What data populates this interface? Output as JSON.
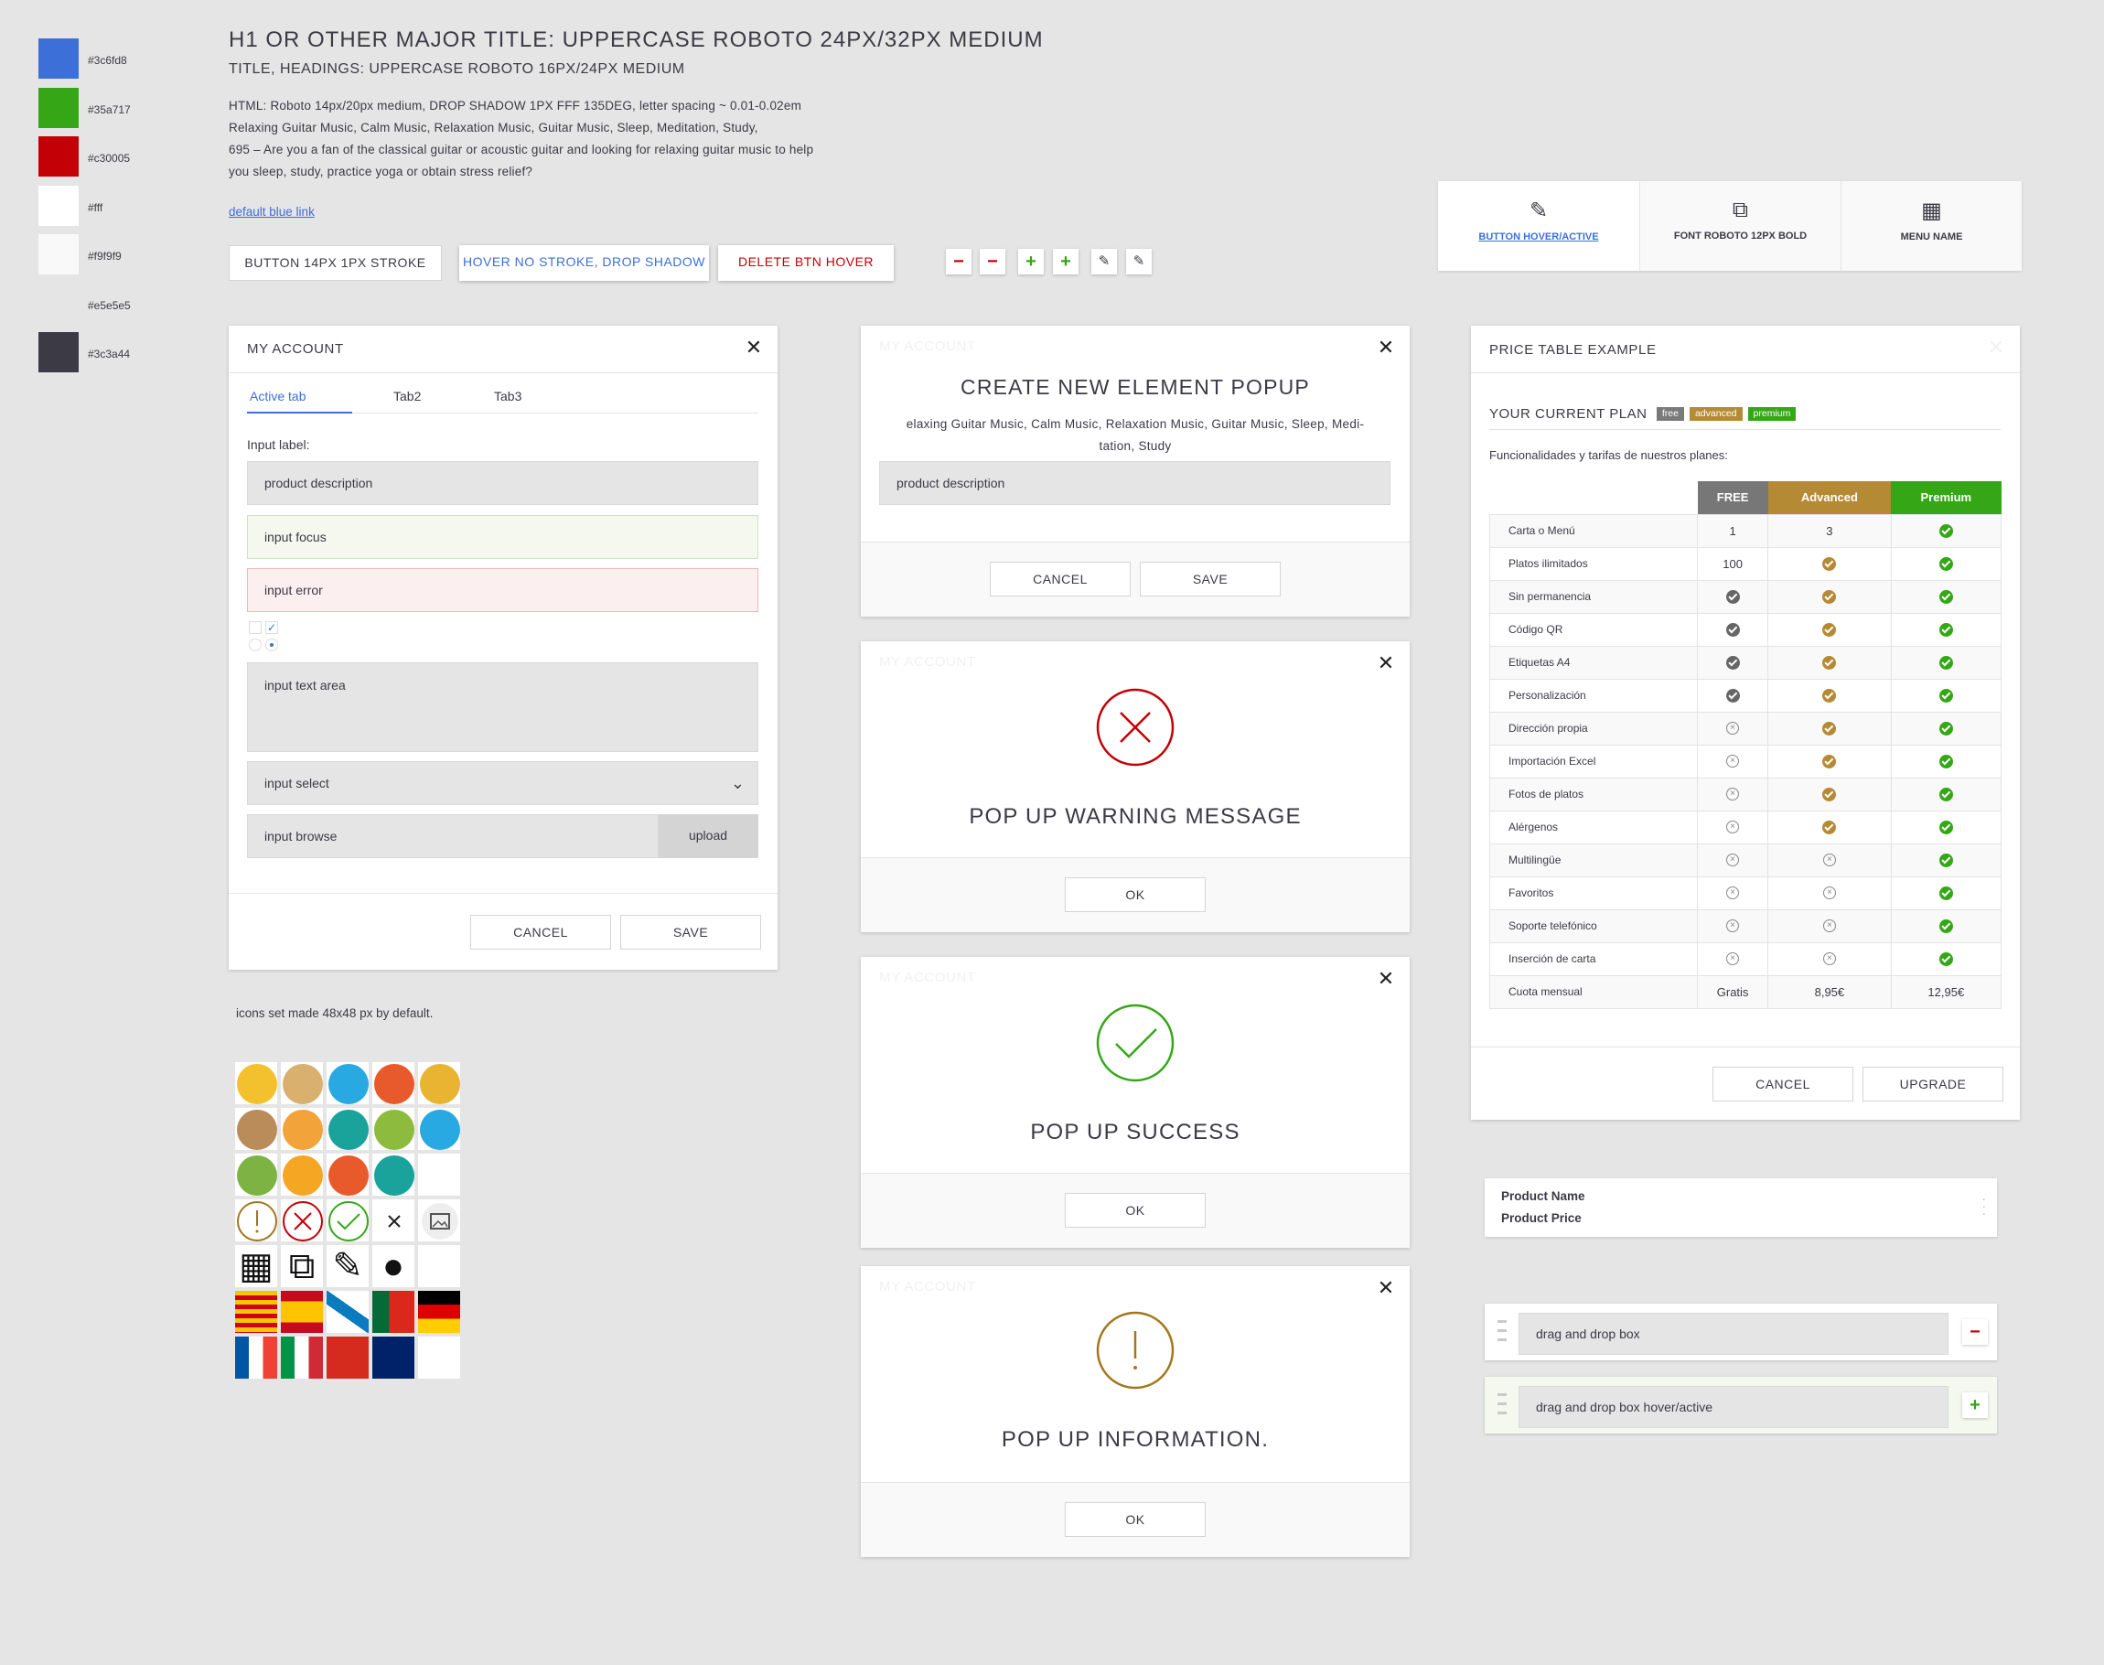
{
  "palette": [
    {
      "hex": "#3c6fd8",
      "label": "#3c6fd8"
    },
    {
      "hex": "#35a717",
      "label": "#35a717"
    },
    {
      "hex": "#c30005",
      "label": "#c30005"
    },
    {
      "hex": "#ffffff",
      "label": "#fff"
    },
    {
      "hex": "#f9f9f9",
      "label": "#f9f9f9"
    },
    {
      "hex": "#e5e5e5",
      "label": "#e5e5e5"
    },
    {
      "hex": "#3c3a44",
      "label": "#3c3a44"
    }
  ],
  "typography": {
    "h1": "H1 OR OTHER MAJOR TITLE: UPPERCASE ROBOTO 24PX/32PX MEDIUM",
    "h2": "TITLE, HEADINGS: UPPERCASE ROBOTO 16PX/24PX MEDIUM",
    "lines": [
      "HTML: Roboto 14px/20px medium, DROP SHADOW 1PX FFF 135DEG, letter spacing ~ 0.01-0.02em",
      "Relaxing Guitar Music, Calm Music, Relaxation Music, Guitar Music, Sleep, Meditation, Study,",
      "695 – Are you a fan of the classical guitar or acoustic guitar and looking for relaxing guitar music to help",
      "you sleep, study, practice yoga or obtain stress relief?"
    ],
    "link": "default blue link"
  },
  "buttons": {
    "stroke": "BUTTON 14PX 1PX STROKE",
    "hover": "HOVER NO STROKE, DROP SHADOW",
    "delete": "DELETE BTN HOVER",
    "small": [
      "minus",
      "minus",
      "plus",
      "plus",
      "pencil",
      "pencil"
    ]
  },
  "menu": {
    "items": [
      {
        "label": "BUTTON HOVER/ACTIVE",
        "icon": "pencil-icon"
      },
      {
        "label": "FONT ROBOTO 12PX BOLD",
        "icon": "external-link-icon"
      },
      {
        "label": "MENU NAME",
        "icon": "qr-code-icon"
      }
    ]
  },
  "account": {
    "title": "MY ACCOUNT",
    "tabs": [
      "Active tab",
      "Tab2",
      "Tab3"
    ],
    "input_label": "Input label:",
    "field_default": "product description",
    "field_focus": "input focus",
    "field_error": "input error",
    "textarea": "input text area",
    "select": "input select",
    "browse": "input browse",
    "upload": "upload",
    "cancel": "CANCEL",
    "save": "SAVE"
  },
  "create_popup": {
    "ghost": "MY ACCOUNT",
    "title": "CREATE NEW ELEMENT POPUP",
    "desc1": "elaxing Guitar Music, Calm Music, Relaxation Music, Guitar Music, Sleep, Medi-",
    "desc2": "tation, Study",
    "field": "product description",
    "cancel": "CANCEL",
    "save": "SAVE"
  },
  "warning_popup": {
    "ghost": "MY ACCOUNT",
    "title": "POP UP WARNING MESSAGE",
    "ok": "OK",
    "color": "#c30005"
  },
  "success_popup": {
    "ghost": "MY ACCOUNT",
    "title": "POP UP SUCCESS",
    "ok": "OK",
    "color": "#35a717"
  },
  "info_popup": {
    "ghost": "MY ACCOUNT",
    "title": "POP UP INFORMATION.",
    "ok": "OK",
    "color": "#a2771c"
  },
  "price": {
    "title": "PRICE TABLE EXAMPLE",
    "plan_label": "YOUR CURRENT PLAN",
    "badges": [
      {
        "label": "free",
        "color": "#7a7a7a"
      },
      {
        "label": "advanced",
        "color": "#b58a34"
      },
      {
        "label": "premium",
        "color": "#35a717"
      }
    ],
    "subtitle": "Funcionalidades y tarifas de nuestros planes:",
    "columns": [
      {
        "label": "FREE",
        "color": "#777777"
      },
      {
        "label": "Advanced",
        "color": "#b58a34"
      },
      {
        "label": "Premium",
        "color": "#35a717"
      }
    ],
    "rows": [
      {
        "feature": "Carta o Menú",
        "free": "1",
        "advanced": "3",
        "premium": "check"
      },
      {
        "feature": "Platos ilimitados",
        "free": "100",
        "advanced": "check",
        "premium": "check"
      },
      {
        "feature": "Sin permanencia",
        "free": "check",
        "advanced": "check",
        "premium": "check"
      },
      {
        "feature": "Código QR",
        "free": "check",
        "advanced": "check",
        "premium": "check"
      },
      {
        "feature": "Etiquetas A4",
        "free": "check",
        "advanced": "check",
        "premium": "check"
      },
      {
        "feature": "Personalización",
        "free": "check",
        "advanced": "check",
        "premium": "check"
      },
      {
        "feature": "Dirección propia",
        "free": "x",
        "advanced": "check",
        "premium": "check"
      },
      {
        "feature": "Importación Excel",
        "free": "x",
        "advanced": "check",
        "premium": "check"
      },
      {
        "feature": "Fotos de platos",
        "free": "x",
        "advanced": "check",
        "premium": "check"
      },
      {
        "feature": "Alérgenos",
        "free": "x",
        "advanced": "check",
        "premium": "check"
      },
      {
        "feature": "Multilingüe",
        "free": "x",
        "advanced": "x",
        "premium": "check"
      },
      {
        "feature": "Favoritos",
        "free": "x",
        "advanced": "x",
        "premium": "check"
      },
      {
        "feature": "Soporte telefónico",
        "free": "x",
        "advanced": "x",
        "premium": "check"
      },
      {
        "feature": "Inserción de carta",
        "free": "x",
        "advanced": "x",
        "premium": "check"
      },
      {
        "feature": "Cuota mensual",
        "free": "Gratis",
        "advanced": "8,95€",
        "premium": "12,95€"
      }
    ],
    "cancel": "CANCEL",
    "upgrade": "UPGRADE"
  },
  "product": {
    "name": "Product Name",
    "price": "Product Price"
  },
  "dnd": {
    "box": "drag and drop box",
    "box_active": "drag and drop box hover/active"
  },
  "icons": {
    "caption": "icons set made 48x48 px by default.",
    "rows": [
      [
        {
          "n": "wheat-icon",
          "c": "#f4c12e"
        },
        {
          "n": "shellfish-icon",
          "c": "#d9b06e"
        },
        {
          "n": "milk-icon",
          "c": "#29a9e1"
        },
        {
          "n": "celery-icon",
          "c": "#e85a2c"
        },
        {
          "n": "mustard-icon",
          "c": "#e8b432"
        }
      ],
      [
        {
          "n": "nuts-icon",
          "c": "#b98c5a"
        },
        {
          "n": "peanut-icon",
          "c": "#f2a33a"
        },
        {
          "n": "lupin-icon",
          "c": "#1aa39a"
        },
        {
          "n": "peas-icon",
          "c": "#8dbb3e"
        },
        {
          "n": "sulphites-icon",
          "c": "#29a9e1"
        }
      ],
      [
        {
          "n": "lupin-plant-icon",
          "c": "#7cb342"
        },
        {
          "n": "egg-icon",
          "c": "#f5a623"
        },
        {
          "n": "crab-icon",
          "c": "#e85a2c"
        },
        {
          "n": "fish-icon",
          "c": "#1aa39a"
        },
        {
          "n": "empty",
          "c": "#ffffff"
        }
      ]
    ]
  }
}
